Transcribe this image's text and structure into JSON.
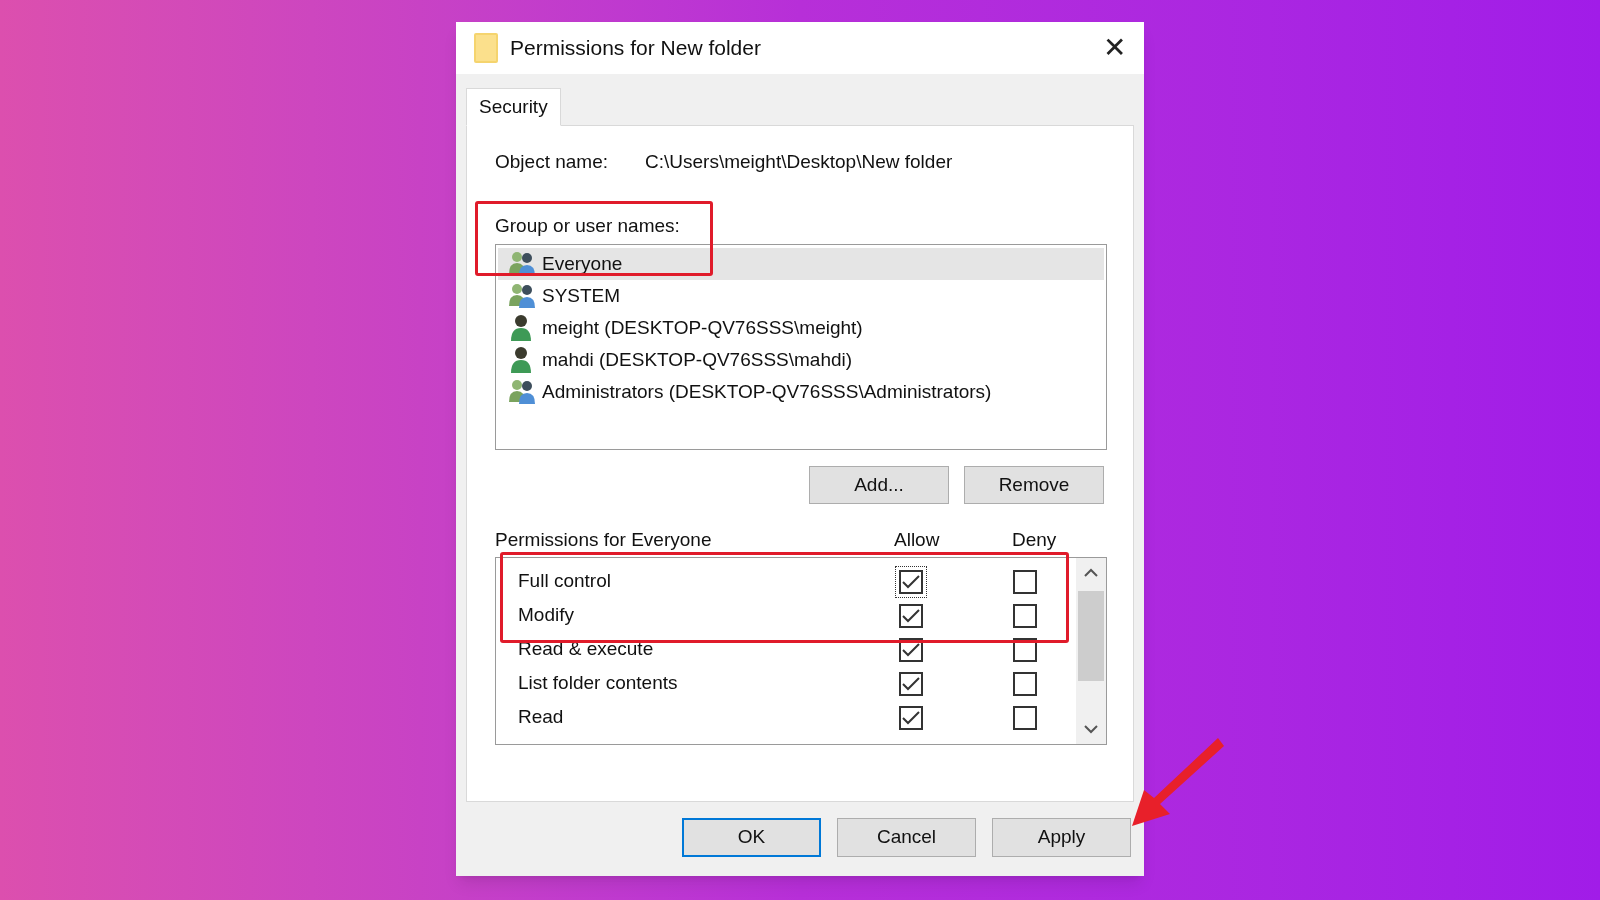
{
  "window": {
    "title": "Permissions for New folder",
    "close": "✕"
  },
  "tabs": [
    {
      "label": "Security",
      "selected": true
    }
  ],
  "object_name": {
    "label": "Object name:",
    "value": "C:\\Users\\meight\\Desktop\\New folder"
  },
  "group_list": {
    "label": "Group or user names:",
    "items": [
      {
        "name": "Everyone",
        "kind": "group",
        "selected": true
      },
      {
        "name": "SYSTEM",
        "kind": "group",
        "selected": false
      },
      {
        "name": "meight (DESKTOP-QV76SSS\\meight)",
        "kind": "user",
        "selected": false
      },
      {
        "name": "mahdi (DESKTOP-QV76SSS\\mahdi)",
        "kind": "user",
        "selected": false
      },
      {
        "name": "Administrators (DESKTOP-QV76SSS\\Administrators)",
        "kind": "group",
        "selected": false
      }
    ]
  },
  "list_buttons": [
    "Add...",
    "Remove"
  ],
  "permissions": {
    "label": "Permissions for Everyone",
    "allow_header": "Allow",
    "deny_header": "Deny",
    "rows": [
      {
        "name": "Full control",
        "allow": true,
        "deny": false,
        "focused": true
      },
      {
        "name": "Modify",
        "allow": true,
        "deny": false,
        "focused": false
      },
      {
        "name": "Read & execute",
        "allow": true,
        "deny": false,
        "focused": false
      },
      {
        "name": "List folder contents",
        "allow": true,
        "deny": false,
        "focused": false
      },
      {
        "name": "Read",
        "allow": true,
        "deny": false,
        "focused": false
      }
    ]
  },
  "dialog_buttons": [
    {
      "label": "OK",
      "default": true
    },
    {
      "label": "Cancel",
      "default": false
    },
    {
      "label": "Apply",
      "default": false
    }
  ]
}
